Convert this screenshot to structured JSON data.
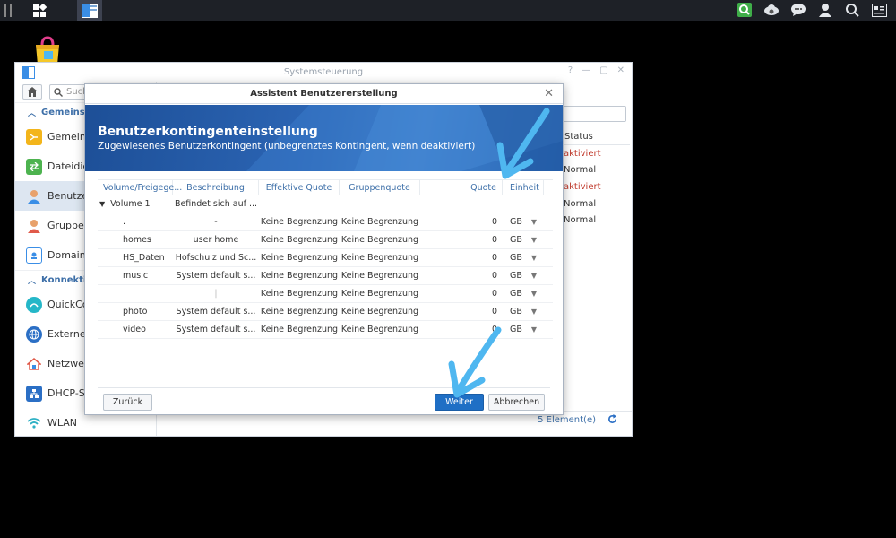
{
  "taskbar": {
    "icons": [
      "menu-icon",
      "main-menu-icon",
      "control-panel-icon",
      "search-app-icon",
      "cloud-sync-icon",
      "chat-icon",
      "user-icon",
      "search-icon",
      "widgets-icon"
    ]
  },
  "window": {
    "title": "Systemsteuerung",
    "search_placeholder": "Such",
    "groups": [
      {
        "label": "Gemeinsam"
      },
      {
        "label": "Konnektivit"
      }
    ],
    "sidebar_items": [
      {
        "label": "Gemeinsa"
      },
      {
        "label": "Dateidien"
      },
      {
        "label": "Benutzer"
      },
      {
        "label": "Gruppe"
      },
      {
        "label": "Domain/L"
      },
      {
        "label": "QuickCon"
      },
      {
        "label": "Externer Z"
      },
      {
        "label": "Netzwerk"
      },
      {
        "label": "DHCP-Ser"
      },
      {
        "label": "WLAN"
      }
    ],
    "status_header": "Status",
    "statuses": [
      "aktiviert",
      "Normal",
      "aktiviert",
      "Normal",
      "Normal"
    ],
    "count_label": "5 Element(e)"
  },
  "dialog": {
    "title": "Assistent Benutzererstellung",
    "heading": "Benutzerkontingenteinstellung",
    "subheading": "Zugewiesenes Benutzerkontingent (unbegrenztes Kontingent, wenn deaktiviert)",
    "columns": [
      "Volume/Freigege...",
      "Beschreibung",
      "Effektive Quote",
      "Gruppenquote",
      "Quote",
      "Einheit"
    ],
    "volume": {
      "name": "Volume 1",
      "description": "Befindet sich auf ..."
    },
    "rows": [
      {
        "name": ".",
        "description": "-",
        "effective": "Keine Begrenzung",
        "group": "Keine Begrenzung",
        "quota": "0",
        "unit": "GB"
      },
      {
        "name": "homes",
        "description": "user home",
        "effective": "Keine Begrenzung",
        "group": "Keine Begrenzung",
        "quota": "0",
        "unit": "GB"
      },
      {
        "name": "HS_Daten",
        "description": "Hofschulz und Sc...",
        "effective": "Keine Begrenzung",
        "group": "Keine Begrenzung",
        "quota": "0",
        "unit": "GB"
      },
      {
        "name": "music",
        "description": "System default s...",
        "effective": "Keine Begrenzung",
        "group": "Keine Begrenzung",
        "quota": "0",
        "unit": "GB"
      },
      {
        "name": "",
        "description": "|",
        "effective": "Keine Begrenzung",
        "group": "Keine Begrenzung",
        "quota": "0",
        "unit": "GB"
      },
      {
        "name": "photo",
        "description": "System default s...",
        "effective": "Keine Begrenzung",
        "group": "Keine Begrenzung",
        "quota": "0",
        "unit": "GB"
      },
      {
        "name": "video",
        "description": "System default s...",
        "effective": "Keine Begrenzung",
        "group": "Keine Begrenzung",
        "quota": "0",
        "unit": "GB"
      }
    ],
    "back_label": "Zurück",
    "next_label": "Weiter",
    "cancel_label": "Abbrechen"
  },
  "colors": {
    "accent": "#1f6fc5",
    "banner": "#2b64b3",
    "arrow": "#4fb7f0",
    "status_red": "#c0392b"
  }
}
